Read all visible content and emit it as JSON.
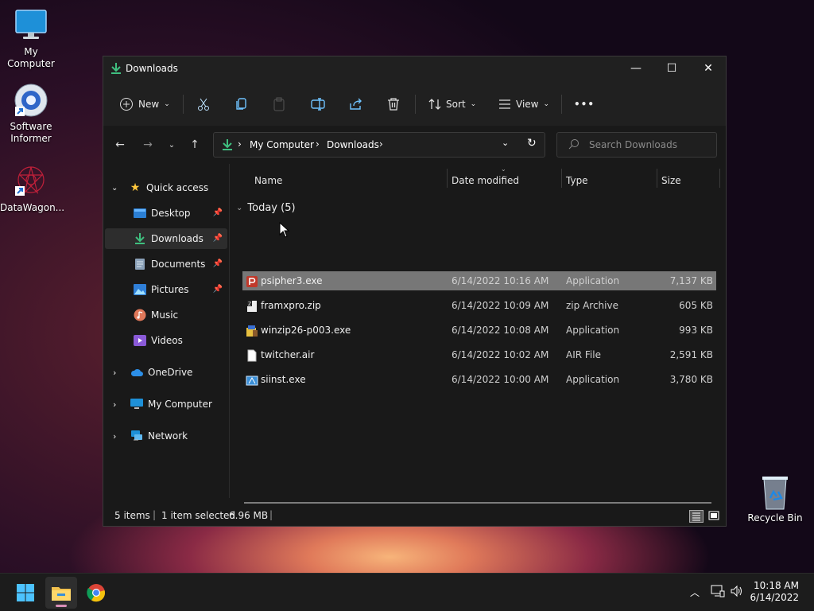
{
  "desktop": {
    "icons": [
      {
        "label": "My Computer"
      },
      {
        "label": "Software\nInformer"
      },
      {
        "label": "DataWagon..."
      },
      {
        "label": "Recycle Bin"
      }
    ]
  },
  "window": {
    "title": "Downloads",
    "controls": {
      "minimize": "—",
      "maximize": "☐",
      "close": "✕"
    }
  },
  "toolbar": {
    "new_label": "New",
    "sort_label": "Sort",
    "view_label": "View",
    "more_label": "•••"
  },
  "address": {
    "crumbs": [
      "My Computer",
      "Downloads"
    ],
    "separator": "›"
  },
  "search": {
    "placeholder": "Search Downloads"
  },
  "sidebar": {
    "quick_access": "Quick access",
    "items": [
      {
        "label": "Desktop",
        "pinned": true
      },
      {
        "label": "Downloads",
        "pinned": true,
        "selected": true
      },
      {
        "label": "Documents",
        "pinned": true
      },
      {
        "label": "Pictures",
        "pinned": true
      },
      {
        "label": "Music",
        "pinned": false
      },
      {
        "label": "Videos",
        "pinned": false
      }
    ],
    "roots": [
      {
        "label": "OneDrive"
      },
      {
        "label": "My Computer"
      },
      {
        "label": "Network"
      }
    ]
  },
  "columns": {
    "name": "Name",
    "date": "Date modified",
    "type": "Type",
    "size": "Size"
  },
  "group": {
    "label": "Today (5)"
  },
  "files": [
    {
      "name": "psipher3.exe",
      "date": "6/14/2022 10:16 AM",
      "type": "Application",
      "size": "7,137 KB",
      "selected": true
    },
    {
      "name": "framxpro.zip",
      "date": "6/14/2022 10:09 AM",
      "type": "zip Archive",
      "size": "605 KB"
    },
    {
      "name": "winzip26-p003.exe",
      "date": "6/14/2022 10:08 AM",
      "type": "Application",
      "size": "993 KB"
    },
    {
      "name": "twitcher.air",
      "date": "6/14/2022 10:02 AM",
      "type": "AIR File",
      "size": "2,591 KB"
    },
    {
      "name": "siinst.exe",
      "date": "6/14/2022 10:00 AM",
      "type": "Application",
      "size": "3,780 KB"
    }
  ],
  "status": {
    "items": "5 items",
    "selected": "1 item selected",
    "size": "6.96 MB"
  },
  "taskbar": {
    "time": "10:18 AM",
    "date": "6/14/2022"
  },
  "colors": {
    "accent": "#4cc2ff",
    "download_green": "#3fbf7f",
    "selected_row": "#777777"
  }
}
